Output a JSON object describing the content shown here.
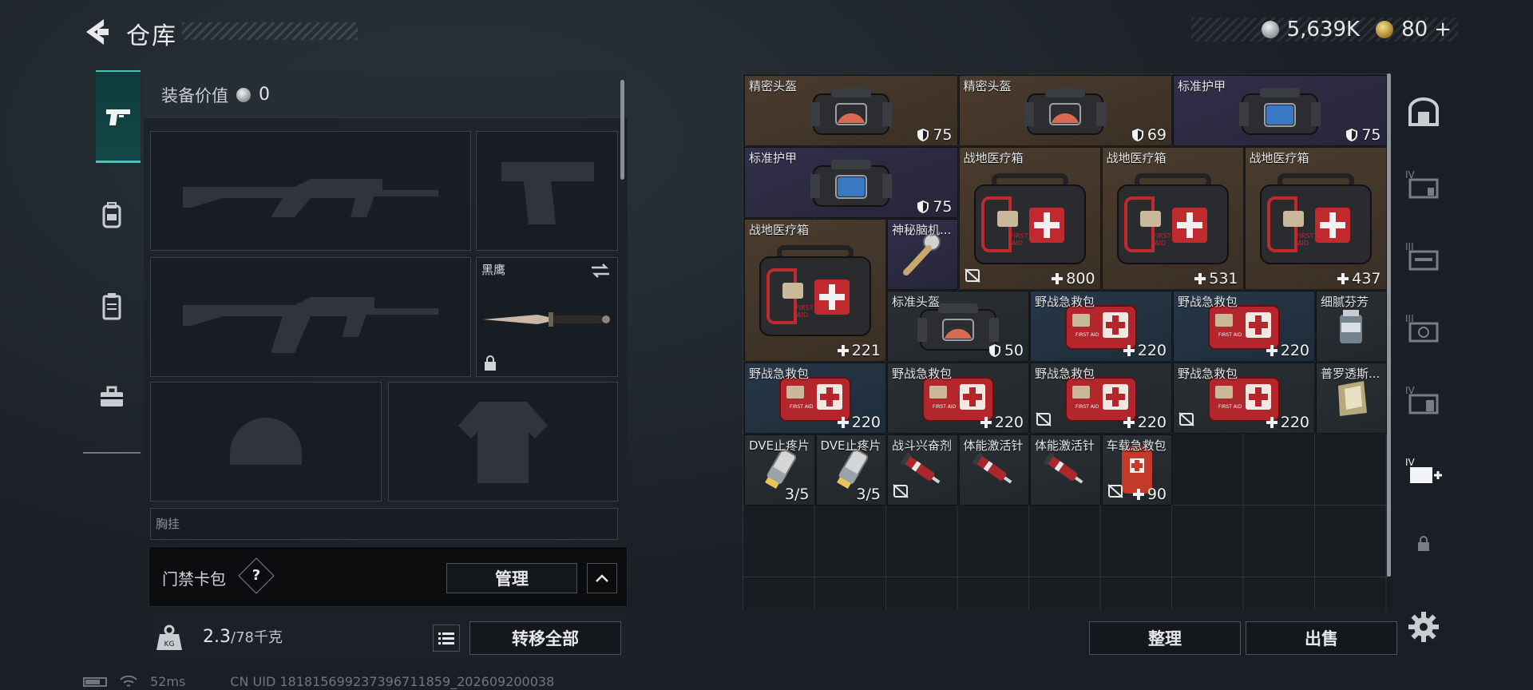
{
  "header": {
    "title": "仓库",
    "silver_amount": "5,639K",
    "gold_amount": "80",
    "gold_plus": "+"
  },
  "left_tabs": [
    "pistol-icon",
    "backpack-icon",
    "vest-icon",
    "toolbox-icon"
  ],
  "equipment": {
    "value_label": "装备价值",
    "value": "0",
    "melee_name": "黑鹰",
    "chest_rig_partial": "胸挂"
  },
  "card_bag": {
    "label": "门禁卡包",
    "help": "?",
    "manage_label": "管理"
  },
  "weight": {
    "current": "2.3",
    "max": "/78千克",
    "transfer_label": "转移全部"
  },
  "status": {
    "ping": "52ms",
    "uid": "CN UID 181815699237396711859_202609200038"
  },
  "storage": {
    "items": [
      {
        "name": "精密头盔",
        "stat": "75",
        "stat_icon": "shield"
      },
      {
        "name": "精密头盔",
        "stat": "69",
        "stat_icon": "shield"
      },
      {
        "name": "标准护甲",
        "stat": "75",
        "stat_icon": "shield"
      },
      {
        "name": "标准护甲",
        "stat": "75",
        "stat_icon": "shield"
      },
      {
        "name": "战地医疗箱",
        "stat": "800",
        "stat_icon": "plus"
      },
      {
        "name": "战地医疗箱",
        "stat": "531",
        "stat_icon": "plus"
      },
      {
        "name": "战地医疗箱",
        "stat": "437",
        "stat_icon": "plus"
      },
      {
        "name": "战地医疗箱",
        "stat": "221",
        "stat_icon": "plus"
      },
      {
        "name": "神秘脑机...",
        "stat": "",
        "stat_icon": ""
      },
      {
        "name": "标准头盔",
        "stat": "50",
        "stat_icon": "shield"
      },
      {
        "name": "野战急救包",
        "stat": "220",
        "stat_icon": "plus"
      },
      {
        "name": "野战急救包",
        "stat": "220",
        "stat_icon": "plus"
      },
      {
        "name": "细腻芬芳",
        "stat": "",
        "stat_icon": ""
      },
      {
        "name": "野战急救包",
        "stat": "220",
        "stat_icon": "plus"
      },
      {
        "name": "野战急救包",
        "stat": "220",
        "stat_icon": "plus"
      },
      {
        "name": "野战急救包",
        "stat": "220",
        "stat_icon": "plus"
      },
      {
        "name": "野战急救包",
        "stat": "220",
        "stat_icon": "plus"
      },
      {
        "name": "普罗透斯...",
        "stat": "",
        "stat_icon": ""
      },
      {
        "name": "DVE止疼片",
        "stat": "3/5",
        "stat_icon": ""
      },
      {
        "name": "DVE止疼片",
        "stat": "3/5",
        "stat_icon": ""
      },
      {
        "name": "战斗兴奋剂",
        "stat": "",
        "stat_icon": ""
      },
      {
        "name": "体能激活针",
        "stat": "",
        "stat_icon": ""
      },
      {
        "name": "体能激活针",
        "stat": "",
        "stat_icon": ""
      },
      {
        "name": "车载急救包",
        "stat": "90",
        "stat_icon": "plus"
      }
    ],
    "sort_label": "整理",
    "sell_label": "出售"
  },
  "right_tabs": [
    "safe-icon",
    "IV",
    "III",
    "III",
    "IV",
    "IV+",
    "lock-icon"
  ],
  "colors": {
    "accent_teal": "#3fc7bd",
    "rarity_brown": "#4a3c2e",
    "rarity_purple": "#312f4a",
    "rarity_blue": "#263747",
    "medkit_red": "#b3262c"
  }
}
